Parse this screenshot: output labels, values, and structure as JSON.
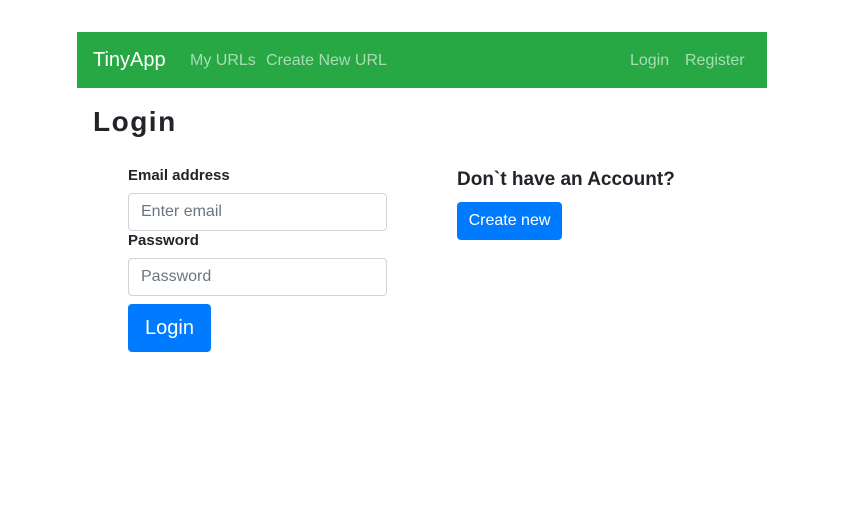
{
  "navbar": {
    "brand": "TinyApp",
    "links": [
      "My URLs",
      "Create New URL"
    ],
    "right_links": [
      "Login",
      "Register"
    ],
    "color": "#28a745"
  },
  "page_title": "Login",
  "form": {
    "email_label": "Email address",
    "email_placeholder": "Enter email",
    "email_value": "",
    "password_label": "Password",
    "password_placeholder": "Password",
    "password_value": "",
    "submit_label": "Login"
  },
  "signup": {
    "heading": "Don`t have an Account?",
    "button_label": "Create new"
  },
  "colors": {
    "primary": "#007bff"
  }
}
